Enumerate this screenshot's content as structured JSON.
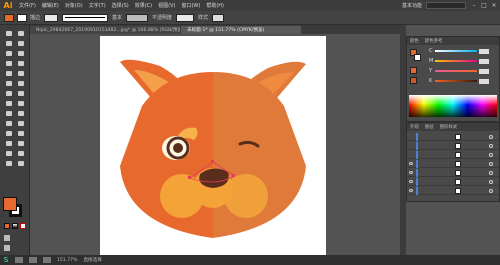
{
  "app": {
    "logo": "Ai"
  },
  "menu": {
    "items": [
      "文件(F)",
      "编辑(E)",
      "对象(O)",
      "文字(T)",
      "选择(S)",
      "效果(C)",
      "视图(V)",
      "窗口(W)",
      "帮助(H)"
    ],
    "workspace": "基本功能",
    "window_controls": [
      "–",
      "□",
      "×"
    ]
  },
  "control_bar": {
    "stroke_label": "描边",
    "stroke_style": "基本",
    "opacity_label": "不透明度",
    "style_label": "样式"
  },
  "tabs": [
    {
      "label": "Nipic_29842667_20190910153482...jpg* @ 166.88% (RGB/预览)",
      "active": false
    },
    {
      "label": "未标题-1* @ 151.77% (CMYK/预览)",
      "active": true
    }
  ],
  "colors": {
    "fill": "#e8692d",
    "stroke": "#ffffff",
    "face_left": "#e8692d",
    "face_right": "#e07a3a",
    "ear_inner": "#f4a04a",
    "cheek": "#f4a338",
    "nose": "#5a2e1c",
    "brow": "#f7b24a"
  },
  "panels": {
    "color_tabs": [
      "颜色",
      "颜色参考"
    ],
    "layer_tabs": [
      "外观",
      "图层",
      "图形样式"
    ],
    "channels": [
      "C",
      "M",
      "Y",
      "K"
    ]
  },
  "status": {
    "zoom": "151.77%",
    "tool": "直接选择"
  }
}
